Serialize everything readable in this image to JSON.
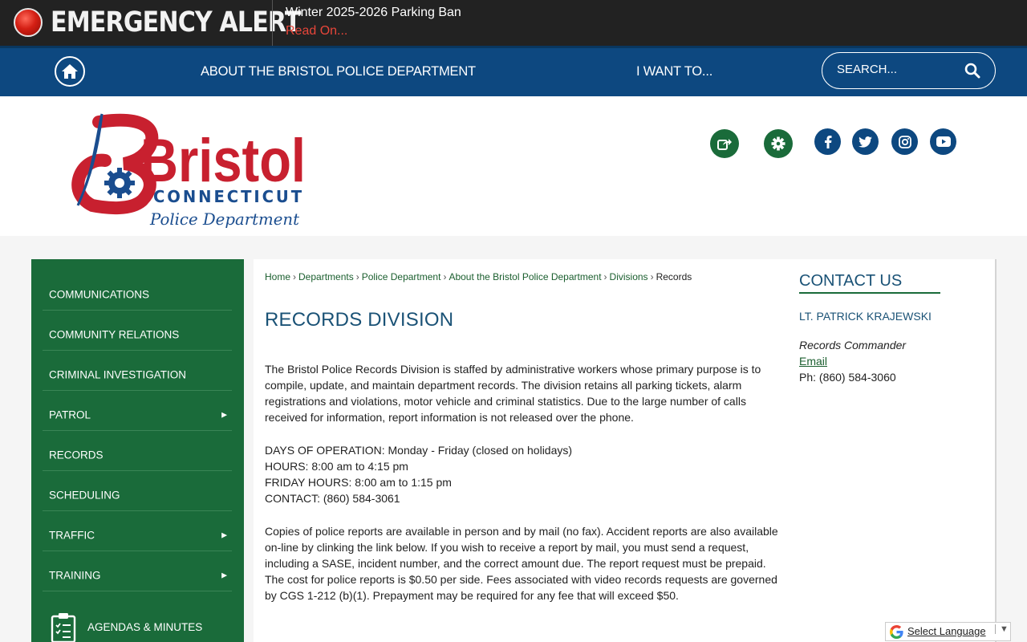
{
  "alert": {
    "title": "EMERGENCY ALERT",
    "message": "Winter 2025-2026 Parking Ban",
    "link": "Read On..."
  },
  "nav": {
    "about": "ABOUT THE BRISTOL POLICE DEPARTMENT",
    "iwant": "I WANT TO...",
    "search_placeholder": "SEARCH..."
  },
  "logo": {
    "name": "Bristol",
    "state": "CONNECTICUT",
    "dept": "Police Department"
  },
  "colors": {
    "alert_bg": "#222222",
    "nav_blue": "#0d4880",
    "sidebar_green": "#1a6b3a",
    "logo_red": "#c8202f",
    "title_blue": "#1a5276"
  },
  "social": [
    "share-icon",
    "gear-icon",
    "facebook-icon",
    "twitter-icon",
    "instagram-icon",
    "youtube-icon"
  ],
  "sidebar": {
    "items": [
      {
        "label": "COMMUNICATIONS",
        "arrow": ""
      },
      {
        "label": "COMMUNITY RELATIONS",
        "arrow": ""
      },
      {
        "label": "CRIMINAL INVESTIGATION",
        "arrow": ""
      },
      {
        "label": "PATROL",
        "arrow": "▶"
      },
      {
        "label": "RECORDS",
        "arrow": ""
      },
      {
        "label": "SCHEDULING",
        "arrow": ""
      },
      {
        "label": "TRAFFIC",
        "arrow": "▶"
      },
      {
        "label": "TRAINING",
        "arrow": "▶"
      }
    ],
    "agendas": "AGENDAS & MINUTES"
  },
  "breadcrumb": {
    "home": "Home",
    "departments": "Departments",
    "police": "Police Department",
    "about": "About the Bristol Police Department",
    "divisions": "Divisions",
    "current": "Records"
  },
  "main": {
    "title": "RECORDS DIVISION",
    "p1": "The Bristol Police Records Division is staffed by administrative workers whose primary purpose is to compile, update, and maintain department records. The division retains all parking tickets, alarm registrations and violations, motor vehicle and criminal statistics. Due to the large number of calls received for information, report information is not released over the phone.",
    "days": "DAYS OF OPERATION: Monday - Friday (closed on holidays)",
    "hours": "HOURS: 8:00 am to 4:15 pm",
    "friday": "FRIDAY HOURS: 8:00 am to 1:15 pm",
    "contact": "CONTACT: (860) 584-3061",
    "p2": "Copies of police reports are available in person and by mail (no fax). Accident reports are also available on-line by clinking the link below. If you wish to receive a report by mail, you must send a request, including a SASE, incident number, and the correct amount due. The report request must be prepaid. The cost for police reports is $0.50 per side. Fees associated with video records requests are governed by CGS 1-212 (b)(1).  Prepayment may be required for any fee that will exceed $50."
  },
  "contact": {
    "heading": "CONTACT US",
    "name": "LT. PATRICK KRAJEWSKI",
    "role": "Records Commander",
    "email": "Email",
    "phone": "Ph: (860) 584-3060"
  },
  "translate": {
    "label": "Select Language",
    "dropdown": "▼"
  }
}
